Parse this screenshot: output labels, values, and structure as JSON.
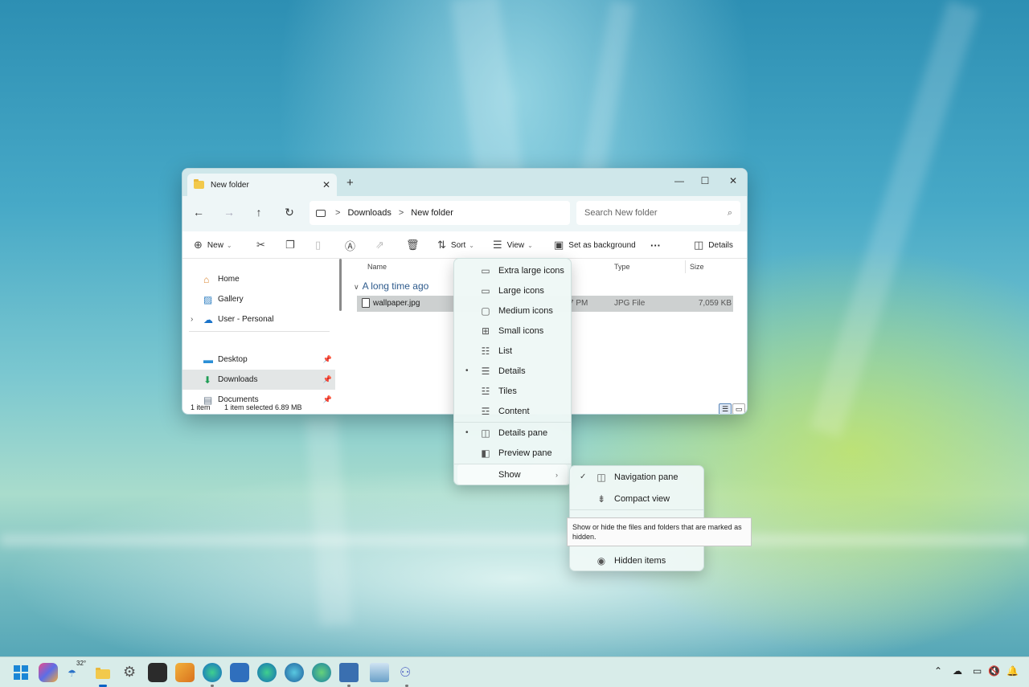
{
  "window": {
    "tab_title": "New folder",
    "tab_close": "✕",
    "new_tab": "+",
    "minimize": "—",
    "maximize": "☐",
    "close": "✕"
  },
  "address": {
    "back": "←",
    "forward": "→",
    "up": "↑",
    "refresh": "↻",
    "crumb_sep": ">",
    "crumbs": [
      "Downloads",
      "New folder"
    ],
    "search_placeholder": "Search New folder",
    "search_glyph": "⌕"
  },
  "commands": {
    "new": "New",
    "sort": "Sort",
    "view": "View",
    "set_background": "Set as background",
    "more": "···",
    "details": "Details"
  },
  "sidebar": {
    "items": [
      {
        "label": "Home",
        "icon": "home-icon"
      },
      {
        "label": "Gallery",
        "icon": "gallery-icon"
      },
      {
        "label": "User - Personal",
        "icon": "onedrive-icon"
      },
      {
        "label": "Desktop",
        "icon": "desktop-icon"
      },
      {
        "label": "Downloads",
        "icon": "download-icon"
      },
      {
        "label": "Documents",
        "icon": "document-icon"
      }
    ]
  },
  "content": {
    "columns": {
      "name": "Name",
      "type": "Type",
      "size": "Size"
    },
    "group": "A long time ago",
    "files": [
      {
        "name": "wallpaper.jpg",
        "date_fragment": "7 PM",
        "type": "JPG File",
        "size": "7,059 KB"
      }
    ]
  },
  "status": {
    "count": "1 item",
    "selected": "1 item selected  6.89 MB"
  },
  "view_menu": {
    "items": [
      {
        "label": "Extra large icons",
        "icon": "extra-large-icons-icon"
      },
      {
        "label": "Large icons",
        "icon": "large-icons-icon"
      },
      {
        "label": "Medium icons",
        "icon": "medium-icons-icon"
      },
      {
        "label": "Small icons",
        "icon": "small-icons-icon"
      },
      {
        "label": "List",
        "icon": "list-icon"
      },
      {
        "label": "Details",
        "icon": "details-icon",
        "selected": true
      },
      {
        "label": "Tiles",
        "icon": "tiles-icon"
      },
      {
        "label": "Content",
        "icon": "content-icon"
      },
      {
        "label": "Details pane",
        "icon": "details-pane-icon",
        "selected": true
      },
      {
        "label": "Preview pane",
        "icon": "preview-pane-icon"
      },
      {
        "label": "Show",
        "icon": "",
        "has_submenu": true
      }
    ]
  },
  "show_menu": {
    "items": [
      {
        "label": "Navigation pane",
        "checked": true
      },
      {
        "label": "Compact view",
        "checked": false
      },
      {
        "label": "Hidden items",
        "checked": false
      }
    ]
  },
  "tooltip": {
    "text": "Show or hide the files and folders that are marked as hidden."
  },
  "taskbar": {
    "weather": "32°",
    "accent": "#0a63c4"
  }
}
